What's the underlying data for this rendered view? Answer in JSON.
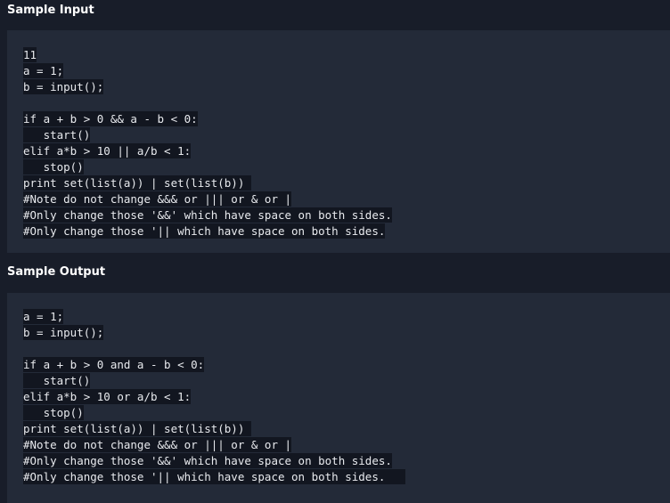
{
  "input_section": {
    "heading": "Sample Input",
    "lines": [
      "11",
      "a = 1;",
      "b = input();",
      "",
      "if a + b > 0 && a - b < 0:",
      "   start()",
      "elif a*b > 10 || a/b < 1:",
      "   stop()",
      "print set(list(a)) | set(list(b)) ",
      "#Note do not change &&& or ||| or & or |",
      "#Only change those '&&' which have space on both sides.",
      "#Only change those '|| which have space on both sides."
    ]
  },
  "output_section": {
    "heading": "Sample Output",
    "lines": [
      "a = 1;",
      "b = input();",
      "",
      "if a + b > 0 and a - b < 0:",
      "   start()",
      "elif a*b > 10 or a/b < 1:",
      "   stop()",
      "print set(list(a)) | set(list(b)) ",
      "#Note do not change &&& or ||| or & or |",
      "#Only change those '&&' which have space on both sides.",
      "#Only change those '|| which have space on both sides.   "
    ]
  }
}
